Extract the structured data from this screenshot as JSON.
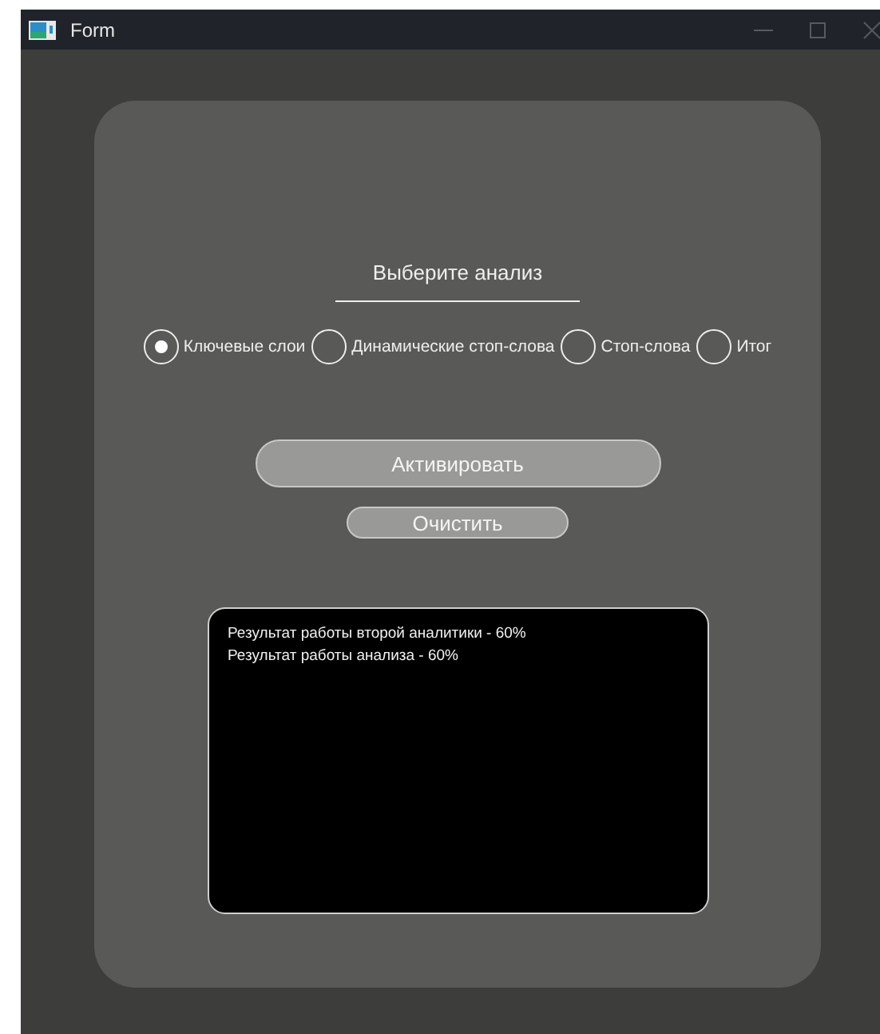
{
  "window": {
    "title": "Form"
  },
  "heading": "Выберите анализ",
  "options": [
    {
      "label": "Ключевые слои",
      "selected": true
    },
    {
      "label": "Динамические стоп-слова",
      "selected": false
    },
    {
      "label": "Стоп-слова",
      "selected": false
    },
    {
      "label": "Итог",
      "selected": false
    }
  ],
  "buttons": [
    {
      "label": "Активировать",
      "kind": "wide"
    },
    {
      "label": "Очистить",
      "kind": "narrow"
    }
  ],
  "output": {
    "lines": [
      "Результат работы второй аналитики - 60%",
      "Результат работы анализа - 60%"
    ]
  }
}
